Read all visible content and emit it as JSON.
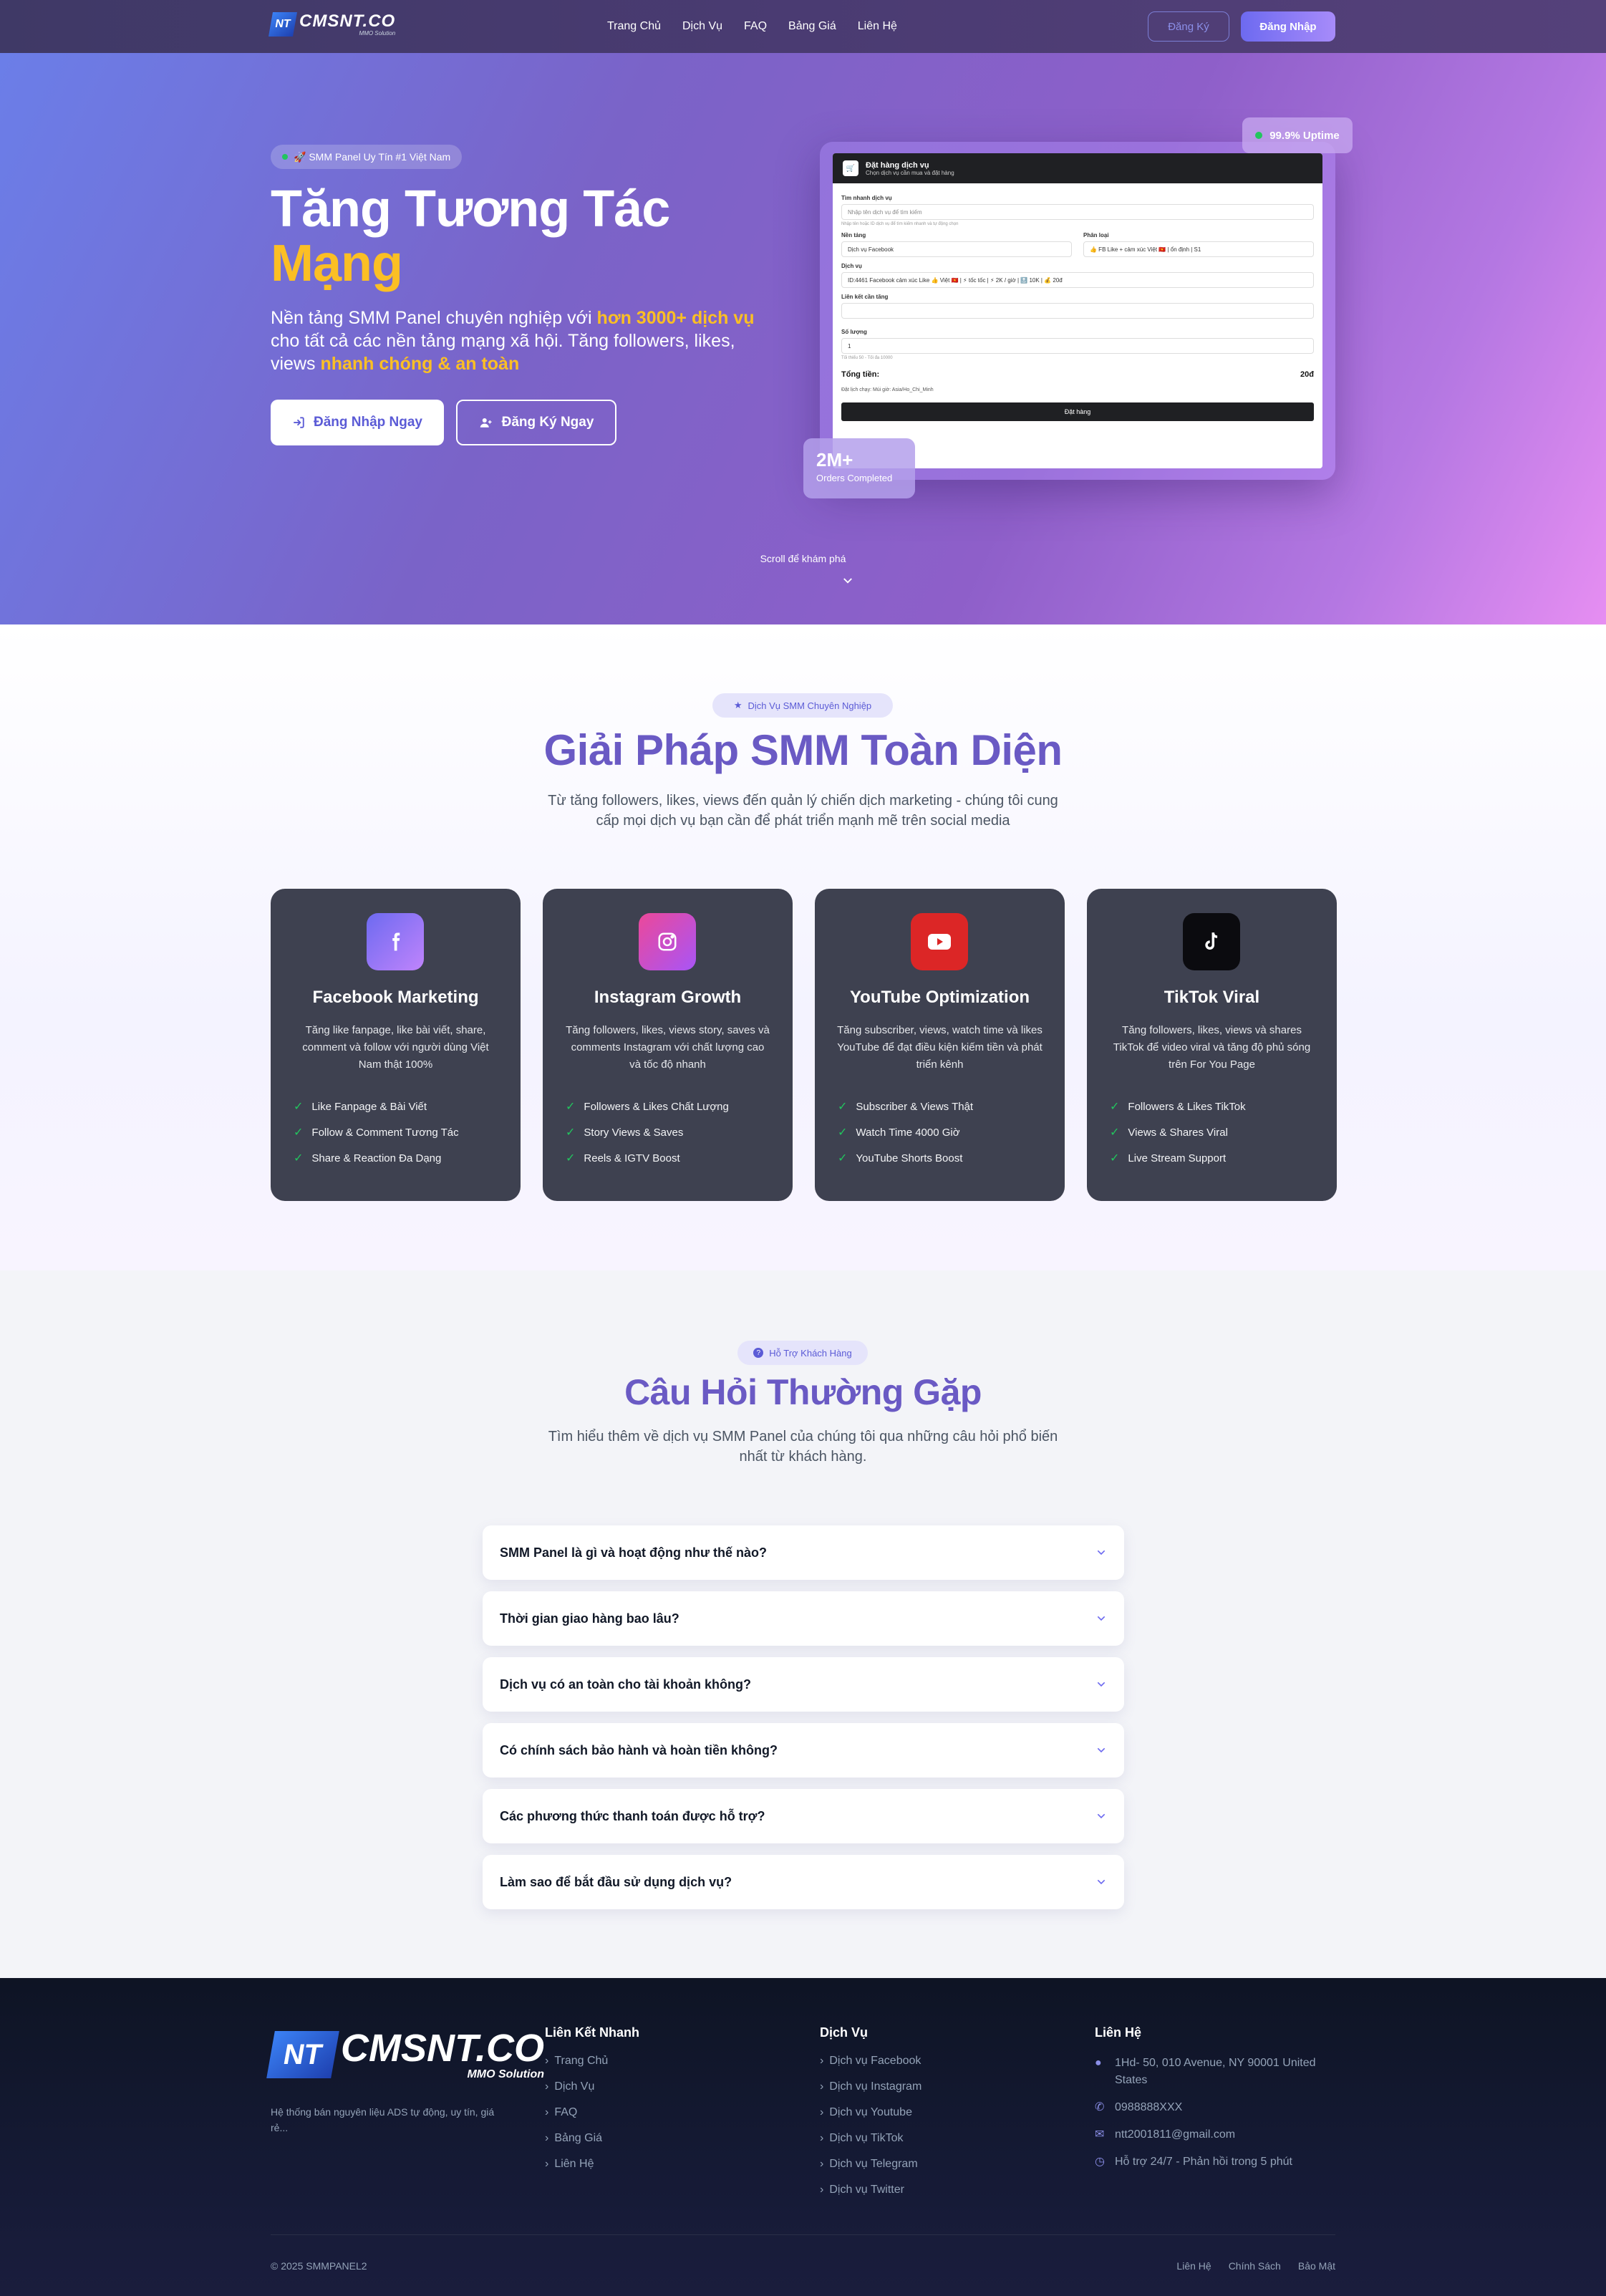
{
  "nav": {
    "logo_text": "CMSNT.CO",
    "logo_sub": "MMO Solution",
    "links": [
      "Trang Chủ",
      "Dịch Vụ",
      "FAQ",
      "Bảng Giá",
      "Liên Hệ"
    ],
    "register": "Đăng Ký",
    "login": "Đăng Nhập"
  },
  "hero": {
    "badge": "🚀 SMM Panel Uy Tín #1 Việt Nam",
    "title_line1": "Tăng Tương Tác",
    "title_line2": "Mạng",
    "sub_a": "Nền tảng SMM Panel chuyên nghiệp với ",
    "sub_hl1": "hơn 3000+ dịch vụ",
    "sub_b": " cho tất cả các nền tảng mạng xã hội. Tăng followers, likes, views ",
    "sub_hl2": "nhanh chóng & an toàn",
    "btn_login": "Đăng Nhập Ngay",
    "btn_register": "Đăng Ký Ngay",
    "uptime": "99.9% Uptime",
    "orders_big": "2M+",
    "orders_small": "Orders Completed",
    "scroll": "Scroll để khám phá"
  },
  "mock": {
    "title": "Đặt hàng dịch vụ",
    "subtitle": "Chọn dịch vụ cần mua và đặt hàng",
    "search_label": "Tìm nhanh dịch vụ",
    "search_ph": "Nhập tên dịch vụ để tìm kiếm",
    "search_hint": "Nhập tên hoặc ID dịch vụ để tìm kiếm nhanh và tự động chọn",
    "platform_label": "Nền tảng",
    "platform_val": "Dịch vụ Facebook",
    "category_label": "Phân loại",
    "category_val": "👍 FB Like + cảm xúc Việt 🇻🇳 | ổn định | S1",
    "service_label": "Dịch vụ",
    "service_val": "ID:4461 Facebook cảm xúc Like 👍 Việt 🇻🇳 | ⚡ tốc tốc | ⚡ 2K / giờ | 🔝 10K | 💰 20đ",
    "link_label": "Liên kết cần tăng",
    "qty_label": "Số lượng",
    "qty_val": "1",
    "qty_hint": "Tối thiểu 50 - Tối đa 10000",
    "total_label": "Tổng tiền:",
    "total_val": "20đ",
    "tz": "Đặt lịch chạy: Múi giờ: Asia/Ho_Chi_Minh",
    "order_btn": "Đặt hàng"
  },
  "services": {
    "pill": "Dịch Vụ SMM Chuyên Nghiệp",
    "title": "Giải Pháp SMM Toàn Diện",
    "sub1": "Từ tăng followers, likes, views đến quản lý chiến dịch marketing - chúng tôi cung",
    "sub2": "cấp mọi dịch vụ bạn cần để phát triển mạnh mẽ trên social media",
    "cards": [
      {
        "title": "Facebook Marketing",
        "desc": "Tăng like fanpage, like bài viết, share, comment và follow với người dùng Việt Nam thật 100%",
        "items": [
          "Like Fanpage & Bài Viết",
          "Follow & Comment Tương Tác",
          "Share & Reaction Đa Dạng"
        ]
      },
      {
        "title": "Instagram Growth",
        "desc": "Tăng followers, likes, views story, saves và comments Instagram với chất lượng cao và tốc độ nhanh",
        "items": [
          "Followers & Likes Chất Lượng",
          "Story Views & Saves",
          "Reels & IGTV Boost"
        ]
      },
      {
        "title": "YouTube Optimization",
        "desc": "Tăng subscriber, views, watch time và likes YouTube để đạt điều kiện kiếm tiền và phát triển kênh",
        "items": [
          "Subscriber & Views Thật",
          "Watch Time 4000 Giờ",
          "YouTube Shorts Boost"
        ]
      },
      {
        "title": "TikTok Viral",
        "desc": "Tăng followers, likes, views và shares TikTok để video viral và tăng độ phủ sóng trên For You Page",
        "items": [
          "Followers & Likes TikTok",
          "Views & Shares Viral",
          "Live Stream Support"
        ]
      }
    ]
  },
  "faq": {
    "pill": "Hỗ Trợ Khách Hàng",
    "title": "Câu Hỏi Thường Gặp",
    "sub1": "Tìm hiểu thêm về dịch vụ SMM Panel của chúng tôi qua những câu hỏi phổ biến",
    "sub2": "nhất từ khách hàng.",
    "questions": [
      "SMM Panel là gì và hoạt động như thế nào?",
      "Thời gian giao hàng bao lâu?",
      "Dịch vụ có an toàn cho tài khoản không?",
      "Có chính sách bảo hành và hoàn tiền không?",
      "Các phương thức thanh toán được hỗ trợ?",
      "Làm sao để bắt đầu sử dụng dịch vụ?"
    ]
  },
  "footer": {
    "logo_text": "CMSNT.CO",
    "logo_sub": "MMO Solution",
    "desc": "Hệ thống bán nguyên liệu ADS tự động, uy tín, giá rẻ...",
    "quick_head": "Liên Kết Nhanh",
    "quick": [
      "Trang Chủ",
      "Dịch Vụ",
      "FAQ",
      "Bảng Giá",
      "Liên Hệ"
    ],
    "svc_head": "Dịch Vụ",
    "svc": [
      "Dịch vụ Facebook",
      "Dịch vụ Instagram",
      "Dịch vụ Youtube",
      "Dịch vụ TikTok",
      "Dịch vụ Telegram",
      "Dịch vụ Twitter"
    ],
    "contact_head": "Liên Hệ",
    "address": "1Hd- 50, 010 Avenue, NY 90001 United States",
    "phone": "0988888XXX",
    "email": "ntt2001811@gmail.com",
    "support": "Hỗ trợ 24/7 - Phản hồi trong 5 phút",
    "copyright": "© 2025 SMMPANEL2",
    "bottom": [
      "Liên Hệ",
      "Chính Sách",
      "Bảo Mật"
    ]
  }
}
